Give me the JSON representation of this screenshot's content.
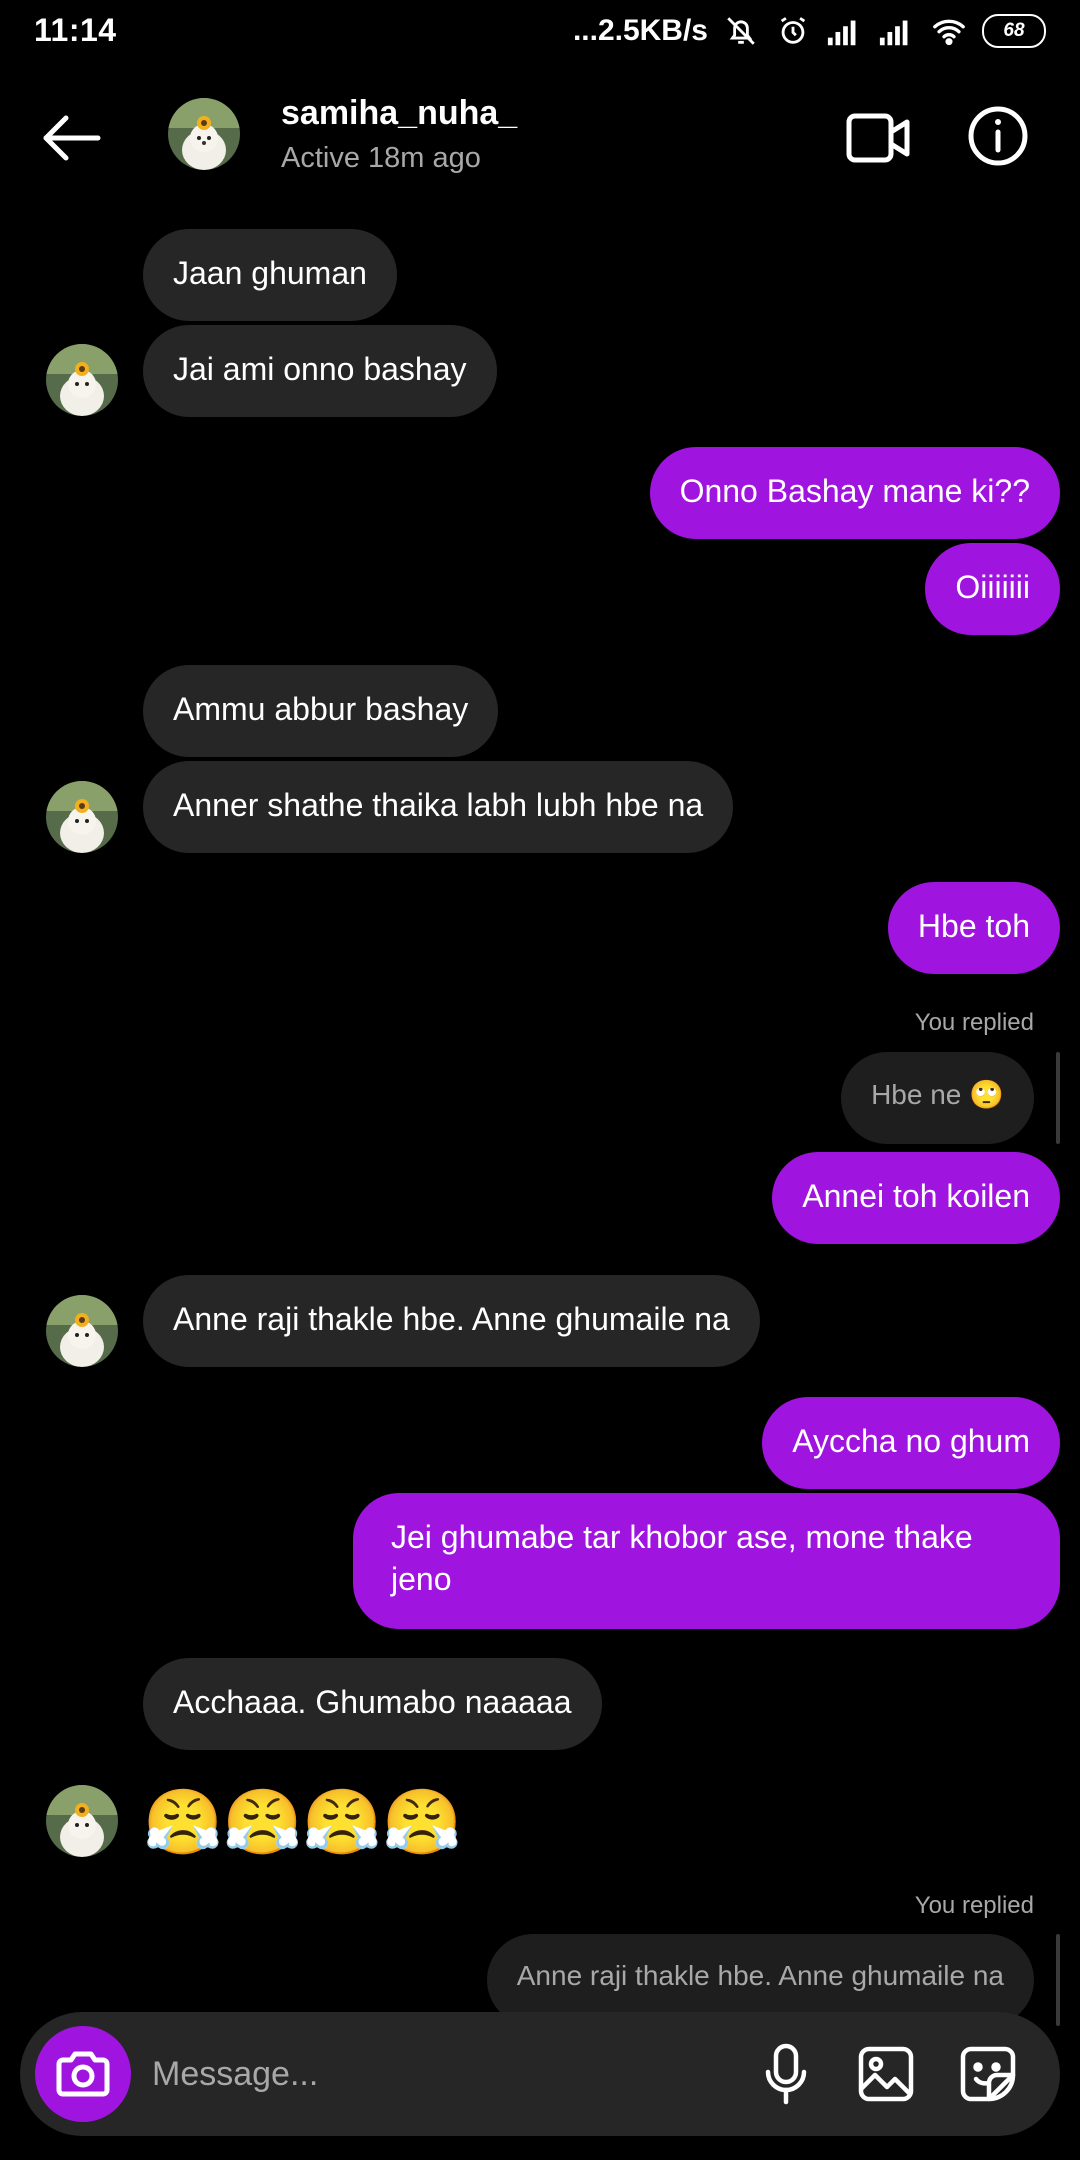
{
  "status_bar": {
    "time": "11:14",
    "network_speed": "...2.5KB/s",
    "battery": "68"
  },
  "header": {
    "username": "samiha_nuha_",
    "activity": "Active 18m ago"
  },
  "messages": [
    {
      "text": "Jaan ghuman"
    },
    {
      "text": "Jai ami onno bashay"
    },
    {
      "text": "Onno Bashay mane ki??"
    },
    {
      "text": "Oiiiiiii"
    },
    {
      "text": "Ammu abbur bashay"
    },
    {
      "text": "Anner shathe thaika labh lubh hbe na"
    },
    {
      "text": "Hbe toh"
    },
    {
      "reply_label": "You replied",
      "reply_text": "Hbe ne 🙄"
    },
    {
      "text": "Annei toh koilen"
    },
    {
      "text": "Anne raji thakle hbe. Anne ghumaile na"
    },
    {
      "text": "Ayccha no ghum"
    },
    {
      "text": "Jei ghumabe tar khobor ase, mone thake jeno"
    },
    {
      "text": "Acchaaa. Ghumabo naaaaa"
    },
    {
      "text": "😤😤😤😤"
    },
    {
      "reply_label": "You replied",
      "reply_text": "Anne raji thakle hbe. Anne ghumaile na"
    }
  ],
  "composer": {
    "placeholder": "Message..."
  },
  "colors": {
    "accent": "#a014e0",
    "incoming_bubble": "#262626",
    "background": "#000000"
  }
}
